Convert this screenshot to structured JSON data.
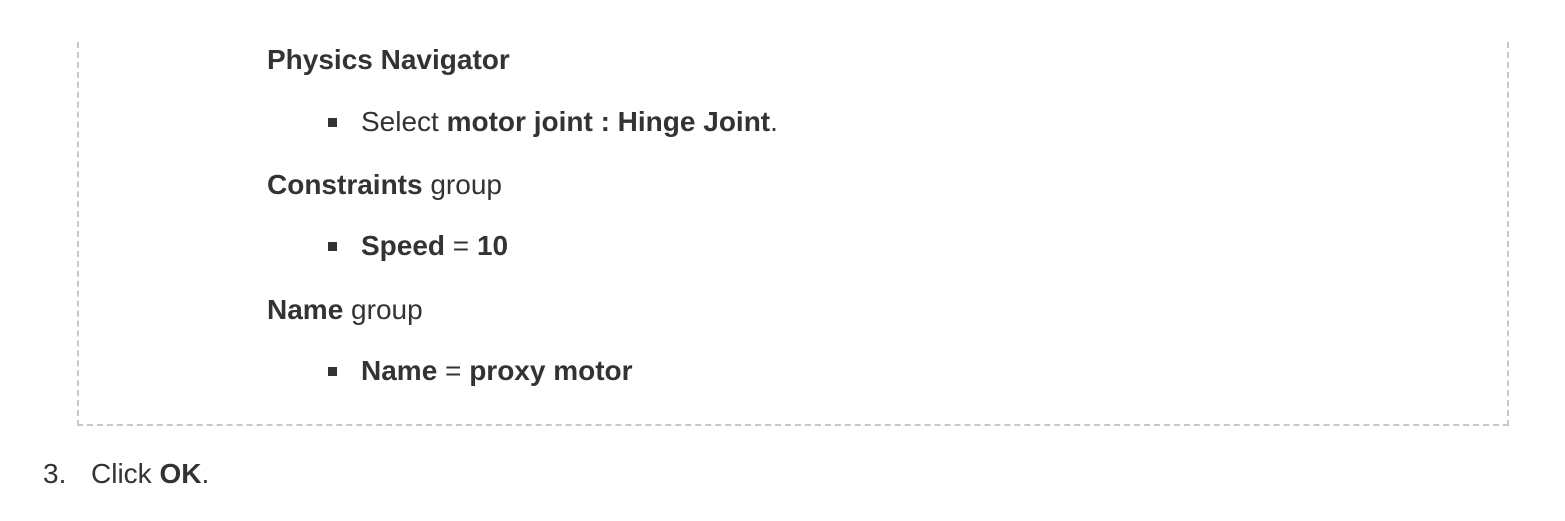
{
  "sections": [
    {
      "heading_bold": "Physics Navigator",
      "heading_rest": "",
      "item": {
        "prefix": "Select ",
        "bold": "motor joint : Hinge Joint",
        "mid": "",
        "bold2": "",
        "suffix": "."
      }
    },
    {
      "heading_bold": "Constraints",
      "heading_rest": " group",
      "item": {
        "prefix": "",
        "bold": "Speed",
        "mid": " = ",
        "bold2": "10",
        "suffix": ""
      }
    },
    {
      "heading_bold": "Name",
      "heading_rest": " group",
      "item": {
        "prefix": "",
        "bold": "Name",
        "mid": " = ",
        "bold2": "proxy motor",
        "suffix": ""
      }
    }
  ],
  "step": {
    "number": "3.",
    "prefix": "Click ",
    "bold": "OK",
    "suffix": "."
  }
}
